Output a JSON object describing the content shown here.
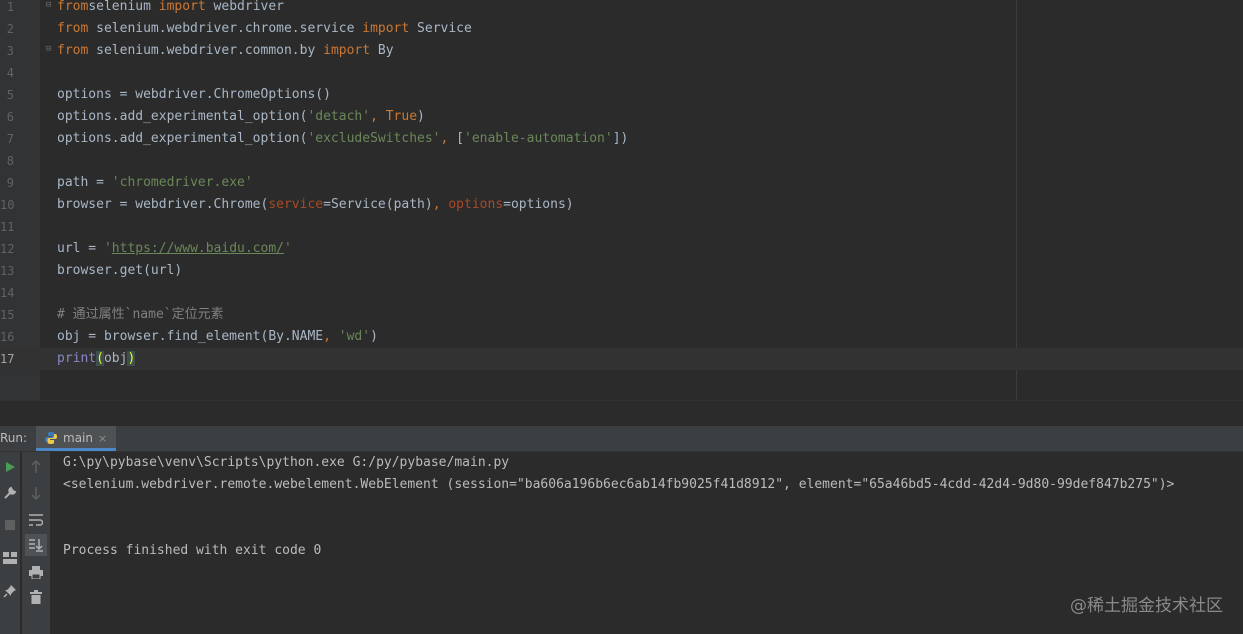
{
  "editor": {
    "lines": [
      {
        "n": "1",
        "segs": [
          [
            "kw",
            "from"
          ],
          [
            "",
            "selenium "
          ],
          [
            "kw",
            "import"
          ],
          [
            "",
            " webdriver"
          ]
        ]
      },
      {
        "n": "2",
        "segs": [
          [
            "kw",
            "from"
          ],
          [
            "",
            " selenium.webdriver.chrome.service "
          ],
          [
            "kw",
            "import"
          ],
          [
            "",
            " Service"
          ]
        ]
      },
      {
        "n": "3",
        "segs": [
          [
            "kw",
            "from"
          ],
          [
            "",
            " selenium.webdriver.common.by "
          ],
          [
            "kw",
            "import"
          ],
          [
            "",
            " By"
          ]
        ]
      },
      {
        "n": "4",
        "segs": []
      },
      {
        "n": "5",
        "segs": [
          [
            "",
            "options = webdriver.ChromeOptions()"
          ]
        ]
      },
      {
        "n": "6",
        "segs": [
          [
            "",
            "options.add_experimental_option("
          ],
          [
            "str",
            "'detach'"
          ],
          [
            "kw",
            ", "
          ],
          [
            "kw",
            "True"
          ],
          [
            "",
            ")"
          ]
        ]
      },
      {
        "n": "7",
        "segs": [
          [
            "",
            "options.add_experimental_option("
          ],
          [
            "str",
            "'excludeSwitches'"
          ],
          [
            "kw",
            ", "
          ],
          [
            "",
            "["
          ],
          [
            "str",
            "'enable-automation'"
          ],
          [
            "",
            "])"
          ]
        ]
      },
      {
        "n": "8",
        "segs": []
      },
      {
        "n": "9",
        "segs": [
          [
            "",
            "path = "
          ],
          [
            "str",
            "'chromedriver.exe'"
          ]
        ]
      },
      {
        "n": "10",
        "segs": [
          [
            "",
            "browser = webdriver.Chrome("
          ],
          [
            "param",
            "service"
          ],
          [
            "",
            "=Service(path)"
          ],
          [
            "kw",
            ", "
          ],
          [
            "param",
            "options"
          ],
          [
            "",
            "=options)"
          ]
        ]
      },
      {
        "n": "11",
        "segs": []
      },
      {
        "n": "12",
        "segs": [
          [
            "",
            "url = "
          ],
          [
            "str",
            "'"
          ],
          [
            "url",
            "https://www.baidu.com/"
          ],
          [
            "str",
            "'"
          ]
        ]
      },
      {
        "n": "13",
        "segs": [
          [
            "",
            "browser.get(url)"
          ]
        ]
      },
      {
        "n": "14",
        "segs": []
      },
      {
        "n": "15",
        "segs": [
          [
            "cmt",
            "# 通过属性`name`定位元素"
          ]
        ]
      },
      {
        "n": "16",
        "segs": [
          [
            "",
            "obj = browser.find_element(By.NAME"
          ],
          [
            "kw",
            ", "
          ],
          [
            "str",
            "'wd'"
          ],
          [
            "",
            ")"
          ]
        ]
      },
      {
        "n": "17",
        "segs": [
          [
            "builtin",
            "print"
          ],
          [
            "brace-hl",
            "("
          ],
          [
            "",
            "obj"
          ],
          [
            "brace-hl",
            ")"
          ]
        ]
      }
    ]
  },
  "run_panel": {
    "label": "Run:",
    "tab_name": "main",
    "tab_close": "×",
    "console_lines": [
      "G:\\py\\pybase\\venv\\Scripts\\python.exe G:/py/pybase/main.py",
      "<selenium.webdriver.remote.webelement.WebElement (session=\"ba606a196b6ec6ab14fb9025f41d8912\", element=\"65a46bd5-4cdd-42d4-9d80-99def847b275\")>",
      "",
      "",
      "Process finished with exit code 0"
    ]
  },
  "tools": {
    "left": [
      "run-icon",
      "wrench-icon",
      "stop-icon",
      "layout-icon",
      "pin-icon"
    ],
    "right": [
      "up-arrow-icon",
      "down-arrow-icon",
      "soft-wrap-icon",
      "scroll-to-end-icon",
      "print-icon",
      "trash-icon"
    ]
  },
  "colors": {
    "background": "#2b2b2b",
    "keyword": "#cc7832",
    "string": "#6a8759",
    "parameter": "#aa4926",
    "comment": "#808080",
    "run_green": "#499c54"
  },
  "watermark": "@稀土掘金技术社区"
}
